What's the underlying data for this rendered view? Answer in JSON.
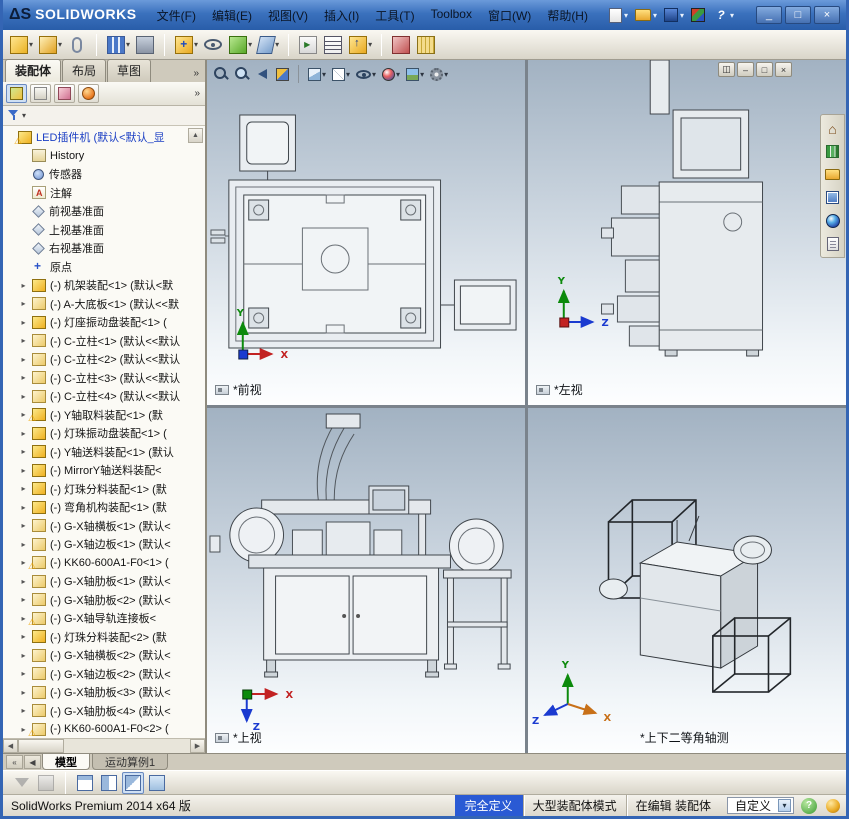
{
  "titlebar": {
    "logo_mark": "ΔS",
    "logo_text": "SOLIDWORKS",
    "menus": [
      "文件(F)",
      "编辑(E)",
      "视图(V)",
      "插入(I)",
      "工具(T)",
      "Toolbox",
      "窗口(W)",
      "帮助(H)"
    ],
    "quick_icons": [
      {
        "name": "new-document-icon",
        "cls": "ico-page",
        "dd": "▾"
      },
      {
        "name": "open-icon",
        "cls": "ico-folder",
        "dd": "▾"
      },
      {
        "name": "save-icon",
        "cls": "ico-disk",
        "dd": "▾"
      },
      {
        "name": "solidworks-resources-icon",
        "cls": "ico-cube3d",
        "dd": ""
      },
      {
        "name": "help-icon",
        "cls": "ico-help",
        "glyph": "?",
        "dd": "▾"
      }
    ],
    "window_controls": [
      {
        "name": "minimize-button",
        "glyph": "_"
      },
      {
        "name": "maximize-button",
        "glyph": "□"
      },
      {
        "name": "close-button",
        "glyph": "×"
      }
    ]
  },
  "toolbar": {
    "icons": [
      {
        "name": "edit-component-icon",
        "cls": "tb tb-yellow",
        "dd": "▾"
      },
      {
        "name": "insert-component-icon",
        "cls": "tb tb-gold",
        "dd": "▾"
      },
      {
        "name": "mate-icon",
        "cls": "tb-clip",
        "dd": ""
      },
      {
        "name": "separator",
        "cls": "tbsep"
      },
      {
        "name": "linear-component-pattern-icon",
        "cls": "tb tb-pattern",
        "dd": "▾"
      },
      {
        "name": "smart-fasteners-icon",
        "cls": "tb tb-bolt",
        "dd": ""
      },
      {
        "name": "separator",
        "cls": "tbsep"
      },
      {
        "name": "move-component-icon",
        "cls": "tb tb-move",
        "dd": "▾"
      },
      {
        "name": "show-hidden-components-icon",
        "cls": "tb-eye",
        "dd": ""
      },
      {
        "name": "assembly-features-icon",
        "cls": "tb tb-green",
        "dd": "▾"
      },
      {
        "name": "reference-geometry-icon",
        "cls": "tb tb-ref",
        "dd": "▾"
      },
      {
        "name": "separator",
        "cls": "tbsep"
      },
      {
        "name": "new-motion-study-icon",
        "cls": "tb tb-motion",
        "dd": ""
      },
      {
        "name": "bill-of-materials-icon",
        "cls": "tb tb-table",
        "dd": ""
      },
      {
        "name": "exploded-view-icon",
        "cls": "tb tb-explode",
        "dd": "▾"
      },
      {
        "name": "separator",
        "cls": "tbsep"
      },
      {
        "name": "interference-detection-icon",
        "cls": "tb tb-interf",
        "dd": ""
      },
      {
        "name": "measure-icon",
        "cls": "tb tb-measure",
        "dd": ""
      }
    ]
  },
  "panel": {
    "tabs": [
      {
        "name": "tab-assembly",
        "label": "装配体",
        "state": "active"
      },
      {
        "name": "tab-layout",
        "label": "布局",
        "state": ""
      },
      {
        "name": "tab-sketch",
        "label": "草图",
        "state": ""
      }
    ],
    "tabs_overflow": "»",
    "fm_icons": [
      {
        "name": "featuremanager-tree-icon",
        "cls": "fm-asm",
        "state": "active"
      },
      {
        "name": "property-manager-icon",
        "cls": "fm-prop",
        "state": ""
      },
      {
        "name": "configuration-manager-icon",
        "cls": "fm-config",
        "state": ""
      },
      {
        "name": "display-manager-icon",
        "cls": "fm-display",
        "state": ""
      }
    ],
    "fm_overflow": "»",
    "filter_dd": "▾",
    "scroll_up": "▲",
    "h_scroll_left": "◀",
    "h_scroll_right": "▶"
  },
  "tree": {
    "items": [
      {
        "row": "rootrow",
        "arrow": "",
        "icon": "tico-asm",
        "warn": "⚠",
        "label": "LED插件机 (默认<默认_显"
      },
      {
        "arrow": "",
        "icon": "tico-hist",
        "label": "History"
      },
      {
        "arrow": "",
        "icon": "tico-sensor",
        "label": "传感器"
      },
      {
        "arrow": "",
        "icon": "tico-ann",
        "glyph": "A",
        "label": "注解"
      },
      {
        "arrow": "",
        "icon": "tico-plane",
        "label": "前视基准面"
      },
      {
        "arrow": "",
        "icon": "tico-plane",
        "label": "上视基准面"
      },
      {
        "arrow": "",
        "icon": "tico-plane",
        "label": "右视基准面"
      },
      {
        "arrow": "",
        "icon": "tico-origin",
        "glyph": "+",
        "label": "原点"
      },
      {
        "arrow": "▸",
        "icon": "tico-asm",
        "label": "(-) 机架装配<1> (默认<默"
      },
      {
        "arrow": "▸",
        "icon": "tico-part",
        "label": "(-) A-大底板<1> (默认<<默"
      },
      {
        "arrow": "▸",
        "icon": "tico-asm",
        "label": "(-) 灯座振动盘装配<1> ("
      },
      {
        "arrow": "▸",
        "icon": "tico-part",
        "label": "(-) C-立柱<1> (默认<<默认"
      },
      {
        "arrow": "▸",
        "icon": "tico-part",
        "label": "(-) C-立柱<2> (默认<<默认"
      },
      {
        "arrow": "▸",
        "icon": "tico-part",
        "label": "(-) C-立柱<3> (默认<<默认"
      },
      {
        "arrow": "▸",
        "icon": "tico-part",
        "label": "(-) C-立柱<4> (默认<<默认"
      },
      {
        "arrow": "▸",
        "icon": "tico-asm",
        "warn": "⚠",
        "label": "(-) Y轴取料装配<1> (默"
      },
      {
        "arrow": "▸",
        "icon": "tico-asm",
        "label": "(-) 灯珠振动盘装配<1> ("
      },
      {
        "arrow": "▸",
        "icon": "tico-asm",
        "label": "(-) Y轴送料装配<1> (默认"
      },
      {
        "arrow": "▸",
        "icon": "tico-asm",
        "label": "(-) MirrorY轴送料装配<"
      },
      {
        "arrow": "▸",
        "icon": "tico-asm",
        "label": "(-) 灯珠分料装配<1> (默"
      },
      {
        "arrow": "▸",
        "icon": "tico-asm",
        "label": "(-) 弯角机构装配<1> (默"
      },
      {
        "arrow": "▸",
        "icon": "tico-part",
        "label": "(-) G-X轴横板<1> (默认<"
      },
      {
        "arrow": "▸",
        "icon": "tico-part",
        "label": "(-) G-X轴边板<1> (默认<"
      },
      {
        "arrow": "▸",
        "icon": "tico-part",
        "warn": "⚠",
        "label": "(-) KK60-600A1-F0<1> ("
      },
      {
        "arrow": "▸",
        "icon": "tico-part",
        "label": "(-) G-X轴肋板<1> (默认<"
      },
      {
        "arrow": "▸",
        "icon": "tico-part",
        "label": "(-) G-X轴肋板<2> (默认<"
      },
      {
        "arrow": "▸",
        "icon": "tico-part",
        "warn": "⚠",
        "label": "(-) G-X轴导轨连接板<"
      },
      {
        "arrow": "▸",
        "icon": "tico-asm",
        "label": "(-) 灯珠分料装配<2> (默"
      },
      {
        "arrow": "▸",
        "icon": "tico-part",
        "label": "(-) G-X轴横板<2> (默认<"
      },
      {
        "arrow": "▸",
        "icon": "tico-part",
        "label": "(-) G-X轴边板<2> (默认<"
      },
      {
        "arrow": "▸",
        "icon": "tico-part",
        "label": "(-) G-X轴肋板<3> (默认<"
      },
      {
        "arrow": "▸",
        "icon": "tico-part",
        "label": "(-) G-X轴肋板<4> (默认<"
      },
      {
        "arrow": "▸",
        "icon": "tico-part",
        "warn": "⚠",
        "label": "(-) KK60-600A1-F0<2> ("
      }
    ]
  },
  "viewport_toolbar": [
    {
      "name": "zoom-fit-icon",
      "cls": "vi vi-mag",
      "dd": ""
    },
    {
      "name": "zoom-area-icon",
      "cls": "vi vi-magp",
      "dd": ""
    },
    {
      "name": "previous-view-icon",
      "cls": "vi-prev",
      "dd": ""
    },
    {
      "name": "section-view-icon",
      "cls": "vi vi-section",
      "dd": ""
    },
    {
      "name": "separator",
      "cls": "vpsep"
    },
    {
      "name": "view-orientation-icon",
      "cls": "vi vi-cube",
      "dd": "▾"
    },
    {
      "name": "display-style-icon",
      "cls": "vi vi-style",
      "dd": "▾"
    },
    {
      "name": "hide-show-items-icon",
      "cls": "vi-eye",
      "dd": "▾"
    },
    {
      "name": "edit-appearance-icon",
      "cls": "vi vi-sphere",
      "dd": "▾"
    },
    {
      "name": "apply-scene-icon",
      "cls": "vi vi-scene",
      "dd": "▾"
    },
    {
      "name": "view-settings-icon",
      "cls": "vi vi-gear",
      "dd": "▾"
    }
  ],
  "viewport_controls": [
    {
      "name": "tile-viewports-button",
      "glyph": "◫"
    },
    {
      "name": "viewport-minimize-button",
      "glyph": "–"
    },
    {
      "name": "viewport-restore-button",
      "glyph": "□"
    },
    {
      "name": "viewport-close-button",
      "glyph": "×"
    }
  ],
  "taskpane": {
    "icons": [
      {
        "name": "resources-home-icon",
        "cls": "rs rs-home",
        "glyph": "⌂"
      },
      {
        "name": "design-library-icon",
        "cls": "rs rs-lib"
      },
      {
        "name": "file-explorer-icon",
        "cls": "rs rs-folder"
      },
      {
        "name": "view-palette-icon",
        "cls": "rs rs-palette"
      },
      {
        "name": "appearances-icon",
        "cls": "rs rs-sphere"
      },
      {
        "name": "custom-properties-icon",
        "cls": "rs rs-doc"
      }
    ]
  },
  "viewports": [
    {
      "label": "*前视",
      "axis_up": "Y",
      "axis_right": "X"
    },
    {
      "label": "*左视",
      "axis_up": "Y",
      "axis_right": "Z"
    },
    {
      "label": "*上视",
      "axis_right": "X",
      "axis_down": "Z"
    },
    {
      "label": "*上下二等角轴测",
      "axis_up": "Y",
      "axis_right": "X",
      "axis_left": "Z"
    }
  ],
  "bottom_tabs": {
    "nav": [
      {
        "name": "tab-scroll-first-icon",
        "glyph": "«"
      },
      {
        "name": "tab-scroll-left-icon",
        "glyph": "◀"
      }
    ],
    "model": "模型",
    "motion": "运动算例1"
  },
  "bottom_toolbar": [
    {
      "name": "selection-filter-icon",
      "cls": "bb-funnel"
    },
    {
      "name": "hidden-types-icon",
      "cls": "bb bb-gray"
    },
    {
      "name": "separator",
      "cls": "tbsep"
    },
    {
      "name": "single-viewport-icon",
      "cls": "bb bb-pane1",
      "state": ""
    },
    {
      "name": "two-viewport-icon",
      "cls": "bb bb-pane2",
      "state": ""
    },
    {
      "name": "four-viewport-icon",
      "cls": "bb bb-pane4",
      "state": "pressed"
    },
    {
      "name": "link-views-icon",
      "cls": "bb bb-link",
      "state": ""
    }
  ],
  "statusbar": {
    "product": "SolidWorks Premium 2014 x64 版",
    "fully_defined": "完全定义",
    "large_assembly_mode": "大型装配体模式",
    "editing": "在编辑 装配体",
    "custom": "自定义",
    "custom_dd": "▾",
    "help": "?"
  }
}
